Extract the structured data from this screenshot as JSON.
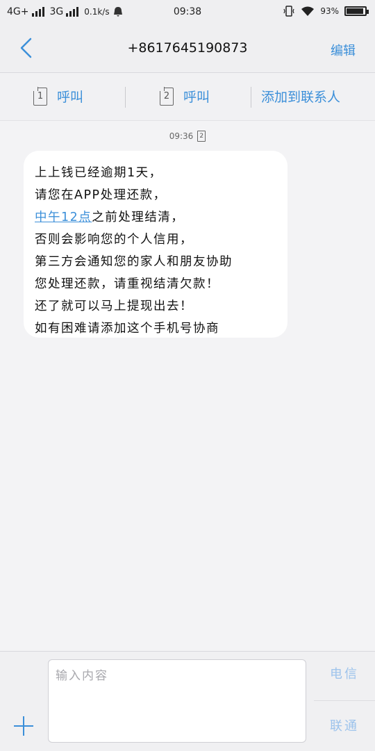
{
  "status_bar": {
    "network1": "4G+",
    "network2": "3G",
    "speed": "0.1k/s",
    "time": "09:38",
    "battery": "93%",
    "battery_level": 0.93
  },
  "header": {
    "phone_number": "+8617645190873",
    "edit_label": "编辑"
  },
  "actions": {
    "call1_sim": "1",
    "call1_label": "呼叫",
    "call2_sim": "2",
    "call2_label": "呼叫",
    "add_contact_label": "添加到联系人"
  },
  "message": {
    "time": "09:36",
    "sim": "2",
    "lines": [
      "上上钱已经逾期1天，",
      "请您在APP处理还款，",
      "之前处理结清，",
      "否则会影响您的个人信用，",
      "第三方会通知您的家人和朋友协助",
      "您处理还款，请重视结清欠款！",
      "还了就可以马上提现出去！",
      "如有困难请添加这个手机号协商"
    ],
    "highlight": "中午12点"
  },
  "input": {
    "placeholder": "输入内容",
    "send_telecom": "电信",
    "send_unicom": "联通"
  },
  "colors": {
    "accent": "#3b8fd9",
    "background": "#f3f3f5",
    "bubble": "#ffffff"
  }
}
